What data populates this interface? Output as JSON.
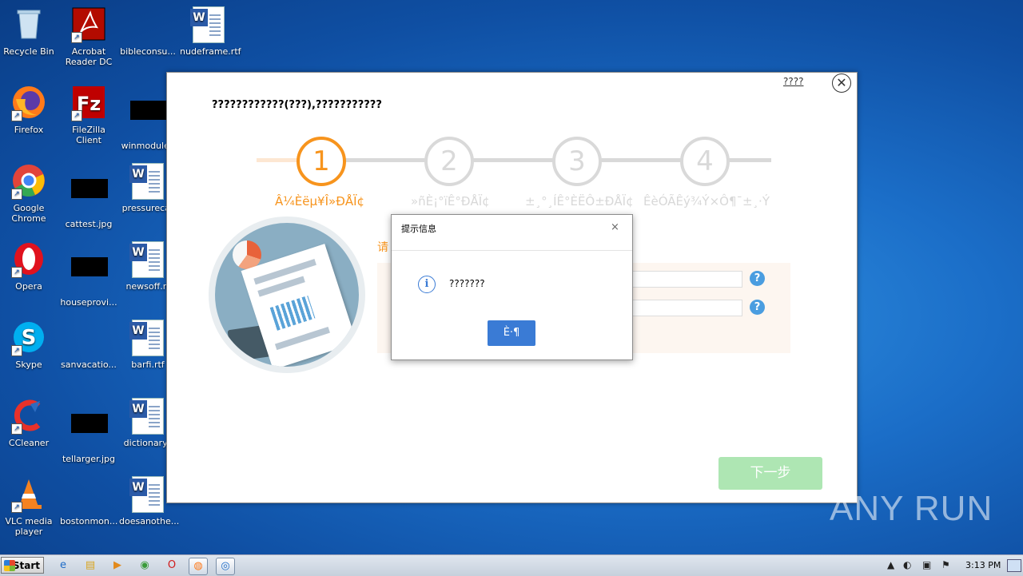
{
  "desktop_icons": [
    {
      "label": "Recycle Bin",
      "type": "recycle"
    },
    {
      "label": "Acrobat Reader DC",
      "type": "acrobat"
    },
    {
      "label": "bibleconsu...",
      "type": "blank"
    },
    {
      "label": "nudeframe.rtf",
      "type": "word"
    },
    {
      "label": "Firefox",
      "type": "firefox"
    },
    {
      "label": "FileZilla Client",
      "type": "filezilla"
    },
    {
      "label": "winmodule.j",
      "type": "black"
    },
    {
      "label": "Google Chrome",
      "type": "chrome"
    },
    {
      "label": "cattest.jpg",
      "type": "black"
    },
    {
      "label": "pressurecar",
      "type": "word"
    },
    {
      "label": "Opera",
      "type": "opera"
    },
    {
      "label": "houseprovi...",
      "type": "black"
    },
    {
      "label": "newsoff.rt",
      "type": "word"
    },
    {
      "label": "Skype",
      "type": "skype"
    },
    {
      "label": "sanvacatio...",
      "type": "blank"
    },
    {
      "label": "barfi.rtf",
      "type": "word"
    },
    {
      "label": "CCleaner",
      "type": "ccleaner"
    },
    {
      "label": "tellarger.jpg",
      "type": "black"
    },
    {
      "label": "dictionarys",
      "type": "word"
    },
    {
      "label": "VLC media player",
      "type": "vlc"
    },
    {
      "label": "bostonmon...",
      "type": "blank"
    },
    {
      "label": "doesanothe...",
      "type": "word"
    }
  ],
  "installer": {
    "help_link": "????",
    "headline": "????????????(???),???????????",
    "steps": [
      {
        "num": "1",
        "label": "Â¼Èëµ¥Î»ÐÅÏ¢",
        "state": "active"
      },
      {
        "num": "2",
        "label": "»ñÈ¡°ïÊ°ÐÅÏ¢",
        "state": "inactive"
      },
      {
        "num": "3",
        "label": "±¸°¸ÍÊ°ÈËÔ±ÐÅÏ¢",
        "state": "inactive"
      },
      {
        "num": "4",
        "label": "ÊèÓÃÊý¾Ý×Ô¶¯±¸·Ý",
        "state": "inactive"
      }
    ],
    "form_label": "请",
    "help_q": "?",
    "next_button": "下一步"
  },
  "dialog": {
    "title": "提示信息",
    "close": "×",
    "message": "???????",
    "info_glyph": "i",
    "ok_button": "È·¶"
  },
  "watermark": "ANY RUN",
  "taskbar": {
    "start": "Start",
    "clock": "3:13 PM"
  },
  "colors": {
    "accent_orange": "#f7941d",
    "step_inactive": "#d9d9d9",
    "dialog_button": "#3a7bd5",
    "next_button": "#aee6b3"
  }
}
